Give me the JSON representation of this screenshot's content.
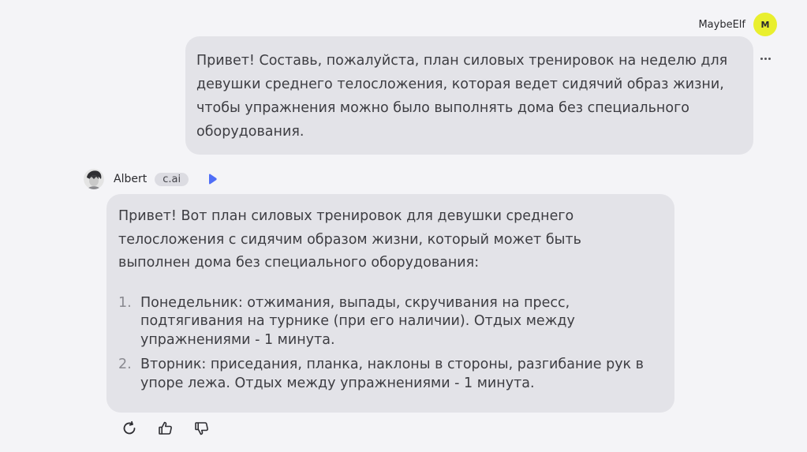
{
  "user_message": {
    "author": "MaybeElf",
    "avatar_letter": "M",
    "avatar_color": "#e9ef2e",
    "lines": [
      "Привет! Составь, пожалуйста, план силовых тренировок на неделю для",
      "девушки среднего телосложения, которая ведет сидячий образ жизни,",
      "чтобы упражнения можно было выполнять дома без специального",
      "оборудования."
    ],
    "more_icon": "more-horizontal-icon"
  },
  "bot_message": {
    "author": "Albert",
    "badge": "c.ai",
    "voice_icon": "play-icon",
    "accent_color": "#4f6ef7",
    "intro_lines": [
      "Привет! Вот план силовых тренировок для девушки среднего",
      "телосложения с сидячим образом жизни, который может быть",
      "выполнен дома без специального оборудования:"
    ],
    "list": [
      {
        "num": "1.",
        "lines": [
          "Понедельник: отжимания, выпады, скручивания на пресс,",
          "подтягивания на турнике (при его наличии). Отдых между",
          "упражнениями - 1 минута."
        ]
      },
      {
        "num": "2.",
        "lines": [
          "Вторник: приседания, планка, наклоны в стороны, разгибание рук в",
          "упоре лежа. Отдых между упражнениями - 1 минута."
        ]
      }
    ]
  },
  "actions": {
    "icons": [
      "refresh-icon",
      "thumbs-up-icon",
      "thumbs-down-icon"
    ]
  }
}
